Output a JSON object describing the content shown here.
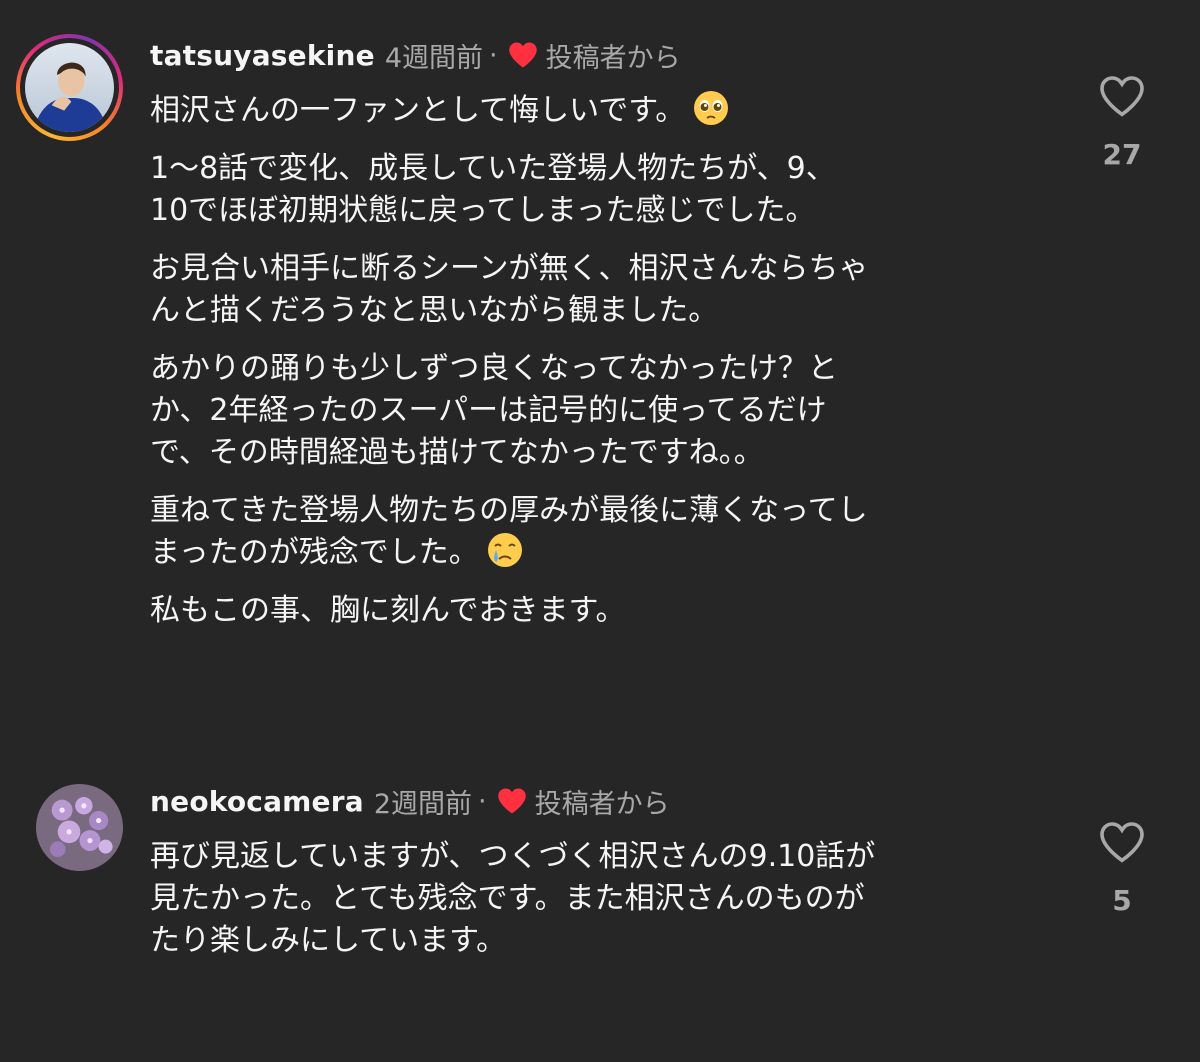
{
  "comments": [
    {
      "username": "tatsuyasekine",
      "time": "4週間前",
      "separator": "·",
      "liked_by_author_icon": "red-heart-icon",
      "by_author_label": "投稿者から",
      "paragraphs": [
        "相沢さんの一ファンとして悔しいです。",
        "1～8話で変化、成長していた登場人物たちが、9、\n10でほぼ初期状態に戻ってしまった感じでした。",
        "お見合い相手に断るシーンが無く、相沢さんならちゃ\nんと描くだろうなと思いながら観ました。",
        "あかりの踊りも少しずつ良くなってなかったけ？と\nか、2年経ったのスーパーは記号的に使ってるだけ\nで、その時間経過も描けてなかったですね。。",
        "重ねてきた登場人物たちの厚みが最後に薄くなってし\nまったのが残念でした。",
        "私もこの事、胸に刻んでおきます。"
      ],
      "emoji_1": "pleading-face-emoji",
      "emoji_2": "crying-face-emoji",
      "like_icon": "heart-outline-icon",
      "like_count": "27"
    },
    {
      "username": "neokocamera",
      "time": "2週間前",
      "separator": "·",
      "liked_by_author_icon": "red-heart-icon",
      "by_author_label": "投稿者から",
      "paragraphs": [
        "再び見返していますが、つくづく相沢さんの9.10話が\n見たかった。とても残念です。また相沢さんのものが\nたり楽しみにしています。"
      ],
      "like_icon": "heart-outline-icon",
      "like_count": "5"
    }
  ],
  "colors": {
    "background": "#262626",
    "text_primary": "#f5f5f5",
    "text_secondary": "#a8a8a8",
    "heart_red": "#ff3040"
  }
}
